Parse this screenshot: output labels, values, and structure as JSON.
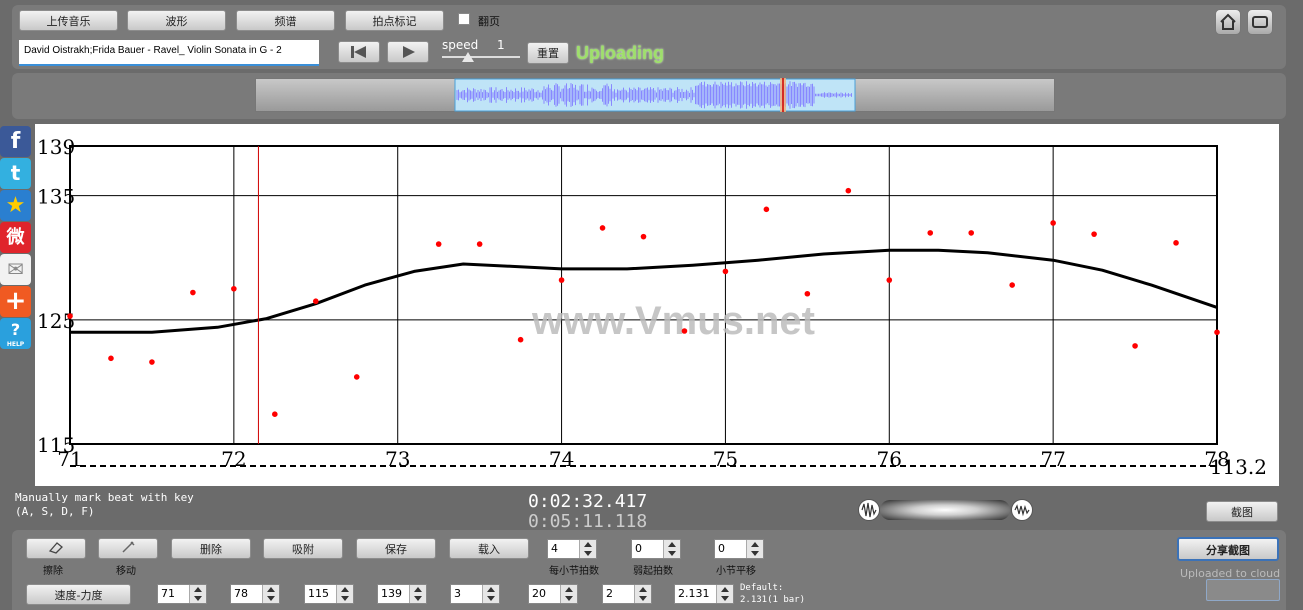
{
  "toolbar": {
    "upload_label": "上传音乐",
    "waveform_label": "波形",
    "spectrum_label": "频谱",
    "beat_mark_label": "拍点标记",
    "flip_label": "翻页",
    "flip_checked": false
  },
  "player": {
    "track_title": "David Oistrakh;Frida Bauer - Ravel_ Violin Sonata in G - 2",
    "speed_label": "speed",
    "speed_value": "1",
    "reset_label": "重置",
    "status": "Uploading"
  },
  "overview": {
    "window_start": 0.25,
    "window_end": 0.75,
    "playhead": 0.66
  },
  "chart_data": {
    "type": "scatter",
    "xlim": [
      71,
      78
    ],
    "ylim": [
      115,
      139
    ],
    "x_ticks": [
      "71",
      "72",
      "73",
      "74",
      "75",
      "76",
      "77",
      "78"
    ],
    "y_ticks": [
      "115",
      "125",
      "135",
      "139"
    ],
    "grid": true,
    "watermark": "www.Vmus.net",
    "bottom_right_value": "113.2",
    "cursor_x": 72.15,
    "points": [
      {
        "x": 71.0,
        "y": 125.3
      },
      {
        "x": 71.25,
        "y": 121.9
      },
      {
        "x": 71.5,
        "y": 121.6
      },
      {
        "x": 71.75,
        "y": 127.2
      },
      {
        "x": 72.0,
        "y": 127.5
      },
      {
        "x": 72.25,
        "y": 117.4
      },
      {
        "x": 72.5,
        "y": 126.5
      },
      {
        "x": 72.75,
        "y": 120.4
      },
      {
        "x": 73.25,
        "y": 131.1
      },
      {
        "x": 73.5,
        "y": 131.1
      },
      {
        "x": 73.75,
        "y": 123.4
      },
      {
        "x": 74.0,
        "y": 128.2
      },
      {
        "x": 74.25,
        "y": 132.4
      },
      {
        "x": 74.5,
        "y": 131.7
      },
      {
        "x": 74.75,
        "y": 124.1
      },
      {
        "x": 75.0,
        "y": 128.9
      },
      {
        "x": 75.25,
        "y": 133.9
      },
      {
        "x": 75.5,
        "y": 127.1
      },
      {
        "x": 75.75,
        "y": 135.4
      },
      {
        "x": 76.0,
        "y": 128.2
      },
      {
        "x": 76.25,
        "y": 132.0
      },
      {
        "x": 76.5,
        "y": 132.0
      },
      {
        "x": 76.75,
        "y": 127.8
      },
      {
        "x": 77.0,
        "y": 132.8
      },
      {
        "x": 77.25,
        "y": 131.9
      },
      {
        "x": 77.5,
        "y": 122.9
      },
      {
        "x": 77.75,
        "y": 131.2
      },
      {
        "x": 78.0,
        "y": 124.0
      }
    ],
    "trend": [
      {
        "x": 71.0,
        "y": 124.0
      },
      {
        "x": 71.5,
        "y": 124.0
      },
      {
        "x": 71.9,
        "y": 124.4
      },
      {
        "x": 72.2,
        "y": 125.1
      },
      {
        "x": 72.5,
        "y": 126.3
      },
      {
        "x": 72.8,
        "y": 127.8
      },
      {
        "x": 73.1,
        "y": 128.9
      },
      {
        "x": 73.4,
        "y": 129.5
      },
      {
        "x": 73.7,
        "y": 129.3
      },
      {
        "x": 74.0,
        "y": 129.1
      },
      {
        "x": 74.4,
        "y": 129.1
      },
      {
        "x": 74.8,
        "y": 129.4
      },
      {
        "x": 75.2,
        "y": 129.8
      },
      {
        "x": 75.6,
        "y": 130.3
      },
      {
        "x": 76.0,
        "y": 130.6
      },
      {
        "x": 76.3,
        "y": 130.6
      },
      {
        "x": 76.6,
        "y": 130.4
      },
      {
        "x": 77.0,
        "y": 129.8
      },
      {
        "x": 77.3,
        "y": 129.0
      },
      {
        "x": 77.6,
        "y": 127.8
      },
      {
        "x": 78.0,
        "y": 126.0
      }
    ]
  },
  "info": {
    "hint_line1": "Manually mark beat with key",
    "hint_line2": "(A, S, D, F)",
    "current_time": "0:02:32.417",
    "total_time": "0:05:11.118",
    "screenshot_label": "截图"
  },
  "controls": {
    "erase_label": "擦除",
    "move_label": "移动",
    "delete_label": "删除",
    "snap_label": "吸附",
    "save_label": "保存",
    "load_label": "载入",
    "beats_per_bar_value": "4",
    "beats_per_bar_label": "每小节拍数",
    "pickup_value": "0",
    "pickup_label": "弱起拍数",
    "bar_shift_value": "0",
    "bar_shift_label": "小节平移",
    "share_label": "分享截图",
    "uploaded_label": "Uploaded to cloud",
    "tempo_label": "速度-力度",
    "x_min_value": "71",
    "x_max_value": "78",
    "y_min_value": "115",
    "y_max_value": "139",
    "field5_value": "3",
    "field6_value": "20",
    "field7_value": "2",
    "field8_value": "2.131",
    "default_line1": "Default:",
    "default_line2": "2.131(1 bar)"
  },
  "colors": {
    "background": "#6b6b6b",
    "accent_green": "#9ee06a",
    "point_red": "#ff0000",
    "cursor_red": "#d00000",
    "waveform": "#8888ff"
  }
}
